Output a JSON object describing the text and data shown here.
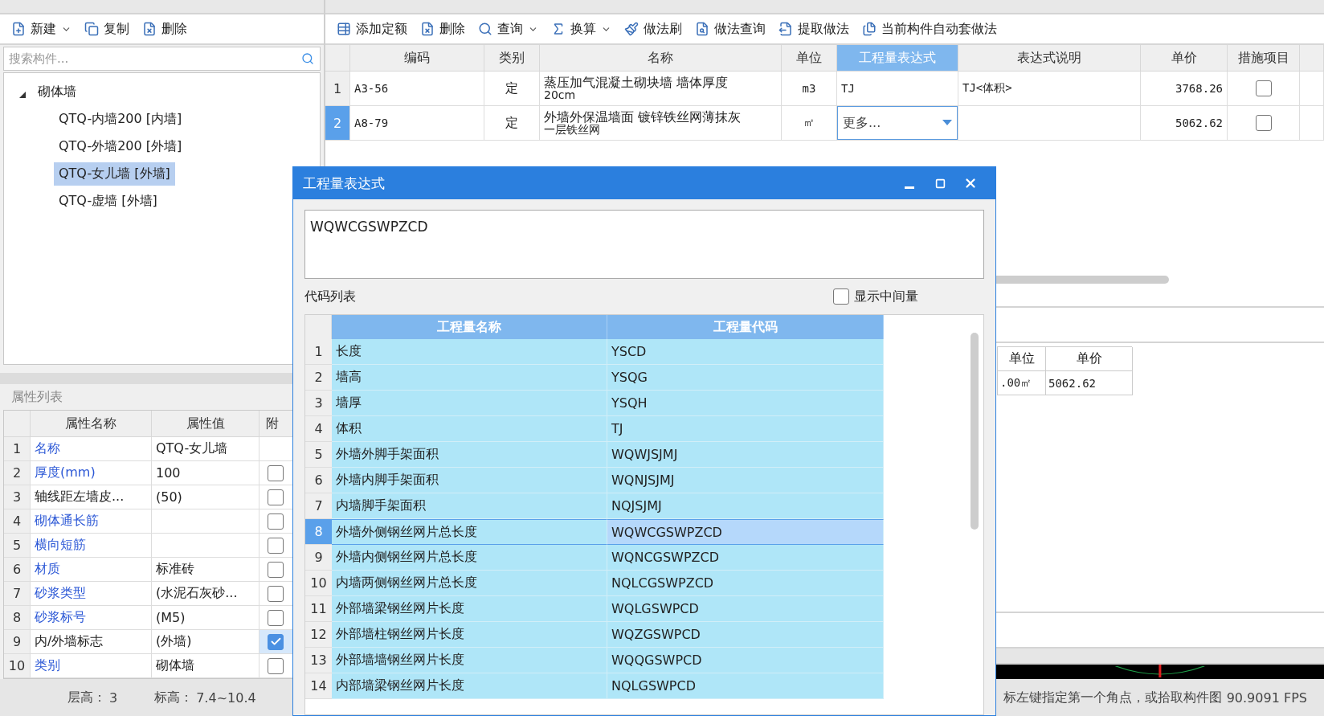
{
  "left_panel": {
    "toolbar": [
      {
        "label": "新建",
        "dropdown": true
      },
      {
        "label": "复制",
        "dropdown": false
      },
      {
        "label": "删除",
        "dropdown": false
      }
    ],
    "search": {
      "placeholder": "搜索构件..."
    },
    "tree": [
      {
        "label": "砌体墙",
        "expanded": true,
        "children": [
          {
            "label": "QTQ-内墙200 [内墙]",
            "selected": false
          },
          {
            "label": "QTQ-外墙200 [外墙]",
            "selected": false
          },
          {
            "label": "QTQ-女儿墙 [外墙]",
            "selected": true
          },
          {
            "label": "QTQ-虚墙 [外墙]",
            "selected": false
          }
        ]
      }
    ]
  },
  "property_panel": {
    "title": "属性列表",
    "columns": [
      "属性名称",
      "属性值",
      "附"
    ],
    "rows": [
      {
        "num": "1",
        "name": "名称",
        "value": "QTQ-女儿墙",
        "link": true
      },
      {
        "num": "2",
        "name": "厚度(mm)",
        "value": "100",
        "link": true,
        "attached": false
      },
      {
        "num": "3",
        "name": "轴线距左墙皮...",
        "value": "(50)",
        "link": false,
        "attached": false
      },
      {
        "num": "4",
        "name": "砌体通长筋",
        "link": true,
        "attached": false
      },
      {
        "num": "5",
        "name": "横向短筋",
        "link": true,
        "attached": false
      },
      {
        "num": "6",
        "name": "材质",
        "value": "标准砖",
        "link": true,
        "attached": false
      },
      {
        "num": "7",
        "name": "砂浆类型",
        "value": "(水泥石灰砂...",
        "link": true,
        "attached": false
      },
      {
        "num": "8",
        "name": "砂浆标号",
        "value": "(M5)",
        "link": true,
        "attached": false
      },
      {
        "num": "9",
        "name": "内/外墙标志",
        "value": "(外墙)",
        "link": false,
        "attached": true
      },
      {
        "num": "10",
        "name": "类别",
        "value": "砌体墙",
        "link": true,
        "attached": false
      }
    ]
  },
  "method_panel": {
    "toolbar": [
      {
        "label": "添加定额",
        "dropdown": false
      },
      {
        "label": "删除",
        "dropdown": false
      },
      {
        "label": "查询",
        "dropdown": true
      },
      {
        "label": "换算",
        "dropdown": true
      },
      {
        "label": "做法刷",
        "dropdown": false
      },
      {
        "label": "做法查询",
        "dropdown": false
      },
      {
        "label": "提取做法",
        "dropdown": false
      },
      {
        "label": "当前构件自动套做法",
        "dropdown": false
      }
    ],
    "columns": [
      {
        "label": "编码",
        "selected": false
      },
      {
        "label": "类别",
        "selected": false
      },
      {
        "label": "名称",
        "selected": false
      },
      {
        "label": "单位",
        "selected": false
      },
      {
        "label": "工程量表达式",
        "selected": true
      },
      {
        "label": "表达式说明",
        "selected": false
      },
      {
        "label": "单价",
        "selected": false
      },
      {
        "label": "措施项目",
        "selected": false
      }
    ],
    "rows": [
      {
        "num": "1",
        "selected": false,
        "code": "A3-56",
        "type": "定",
        "name_lines": [
          "蒸压加气混凝土砌块墙 墙体厚度",
          "20cm"
        ],
        "unit": "m3",
        "expression": {
          "kind": "text",
          "value": "TJ"
        },
        "description": "TJ<体积>",
        "price": "3768.26",
        "measure": false
      },
      {
        "num": "2",
        "selected": true,
        "code": "A8-79",
        "type": "定",
        "name_lines": [
          "外墙外保温墙面 镀锌铁丝网薄抹灰",
          "一层铁丝网"
        ],
        "unit": "㎡",
        "expression": {
          "kind": "dropdown",
          "value": "更多..."
        },
        "price": "5062.62",
        "measure": false
      }
    ]
  },
  "lower_table": {
    "columns": [
      "单位",
      "单价"
    ],
    "rows": [
      [
        ".00㎡",
        "5062.62"
      ]
    ]
  },
  "status_bar": {
    "floor_label": "层高：",
    "floor_value": "3",
    "elevation_label": "标高：",
    "elevation_value": "7.4~10.4",
    "hint": "标左键指定第一个角点，或拾取构件图",
    "fps": "90.9091 FPS"
  },
  "dialog": {
    "title": "工程量表达式",
    "expression": "WQWCGSWPZCD",
    "list_label": "代码列表",
    "show_intermediate": {
      "label": "显示中间量",
      "checked": false
    },
    "columns": [
      "工程量名称",
      "工程量代码"
    ],
    "rows": [
      {
        "num": "1",
        "name": "长度",
        "code": "YSCD",
        "selected": false
      },
      {
        "num": "2",
        "name": "墙高",
        "code": "YSQG",
        "selected": false
      },
      {
        "num": "3",
        "name": "墙厚",
        "code": "YSQH",
        "selected": false
      },
      {
        "num": "4",
        "name": "体积",
        "code": "TJ",
        "selected": false
      },
      {
        "num": "5",
        "name": "外墙外脚手架面积",
        "code": "WQWJSJMJ",
        "selected": false
      },
      {
        "num": "6",
        "name": "外墙内脚手架面积",
        "code": "WQNJSJMJ",
        "selected": false
      },
      {
        "num": "7",
        "name": "内墙脚手架面积",
        "code": "NQJSJMJ",
        "selected": false
      },
      {
        "num": "8",
        "name": "外墙外侧钢丝网片总长度",
        "code": "WQWCGSWPZCD",
        "selected": true
      },
      {
        "num": "9",
        "name": "外墙内侧钢丝网片总长度",
        "code": "WQNCGSWPZCD",
        "selected": false
      },
      {
        "num": "10",
        "name": "内墙两侧钢丝网片总长度",
        "code": "NQLCGSWPZCD",
        "selected": false
      },
      {
        "num": "11",
        "name": "外部墙梁钢丝网片长度",
        "code": "WQLGSWPCD",
        "selected": false
      },
      {
        "num": "12",
        "name": "外部墙柱钢丝网片长度",
        "code": "WQZGSWPCD",
        "selected": false
      },
      {
        "num": "13",
        "name": "外部墙墙钢丝网片长度",
        "code": "WQQGSWPCD",
        "selected": false
      },
      {
        "num": "14",
        "name": "内部墙梁钢丝网片长度",
        "code": "NQLGSWPCD",
        "selected": false
      }
    ]
  }
}
